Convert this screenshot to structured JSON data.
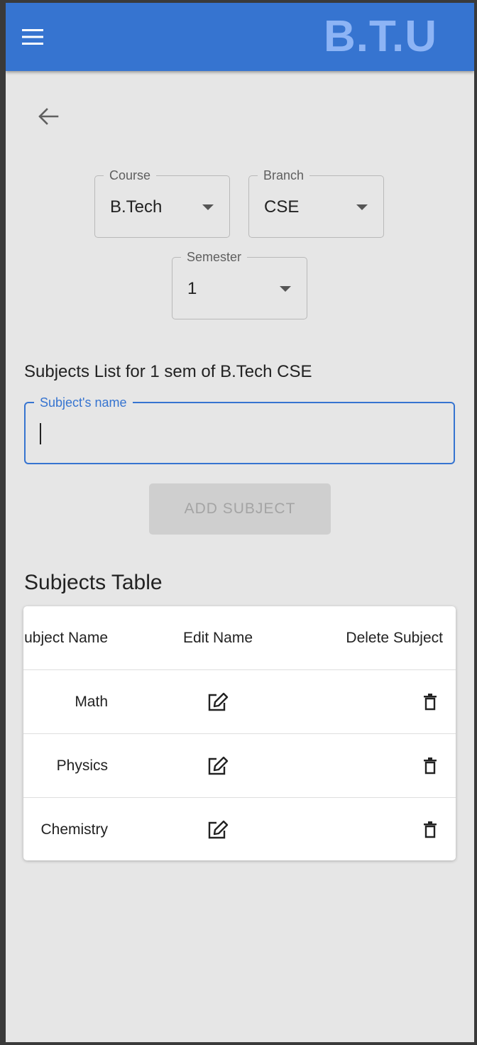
{
  "app": {
    "brand": "B.T.U"
  },
  "filters": {
    "course": {
      "label": "Course",
      "value": "B.Tech"
    },
    "branch": {
      "label": "Branch",
      "value": "CSE"
    },
    "semester": {
      "label": "Semester",
      "value": "1"
    }
  },
  "subjects_list_heading": "Subjects List for 1 sem of B.Tech CSE",
  "subject_input": {
    "label": "Subject's name",
    "value": ""
  },
  "add_button_label": "ADD SUBJECT",
  "table": {
    "title": "Subjects Table",
    "headers": {
      "name": "ubject Name",
      "edit": "Edit Name",
      "delete": "Delete Subject"
    },
    "rows": [
      {
        "name": "Math"
      },
      {
        "name": "Physics"
      },
      {
        "name": "Chemistry"
      }
    ]
  },
  "icons": {
    "menu": "menu-icon",
    "back": "arrow-left-icon",
    "edit": "edit-icon",
    "delete": "trash-icon"
  },
  "colors": {
    "primary": "#3674d0",
    "brand_text": "#8db4f5",
    "background": "#e6e6e6"
  }
}
